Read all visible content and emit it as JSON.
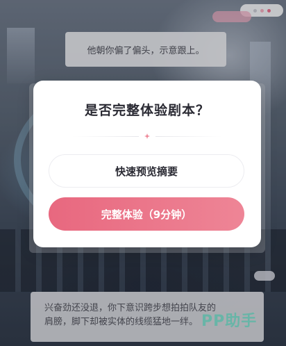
{
  "dialog": {
    "title": "是否完整体验剧本？",
    "preview_button": "快速预览摘要",
    "full_button": "完整体验（9分钟）",
    "divider_icon": "sparkle-icon"
  },
  "background": {
    "top_dialogue": "他朝你偏了偏头，示意跟上。",
    "bottom_dialogue_line1": "兴奋劲还没退，你下意识跨步想拍拍队友的",
    "bottom_dialogue_line2": "肩膀，脚下却被实体的线缆猛地一绊。"
  },
  "watermark": "PP助手",
  "colors": {
    "accent": "#e8687f",
    "accent_end": "#ee8596",
    "watermark": "#6ee1c8"
  }
}
